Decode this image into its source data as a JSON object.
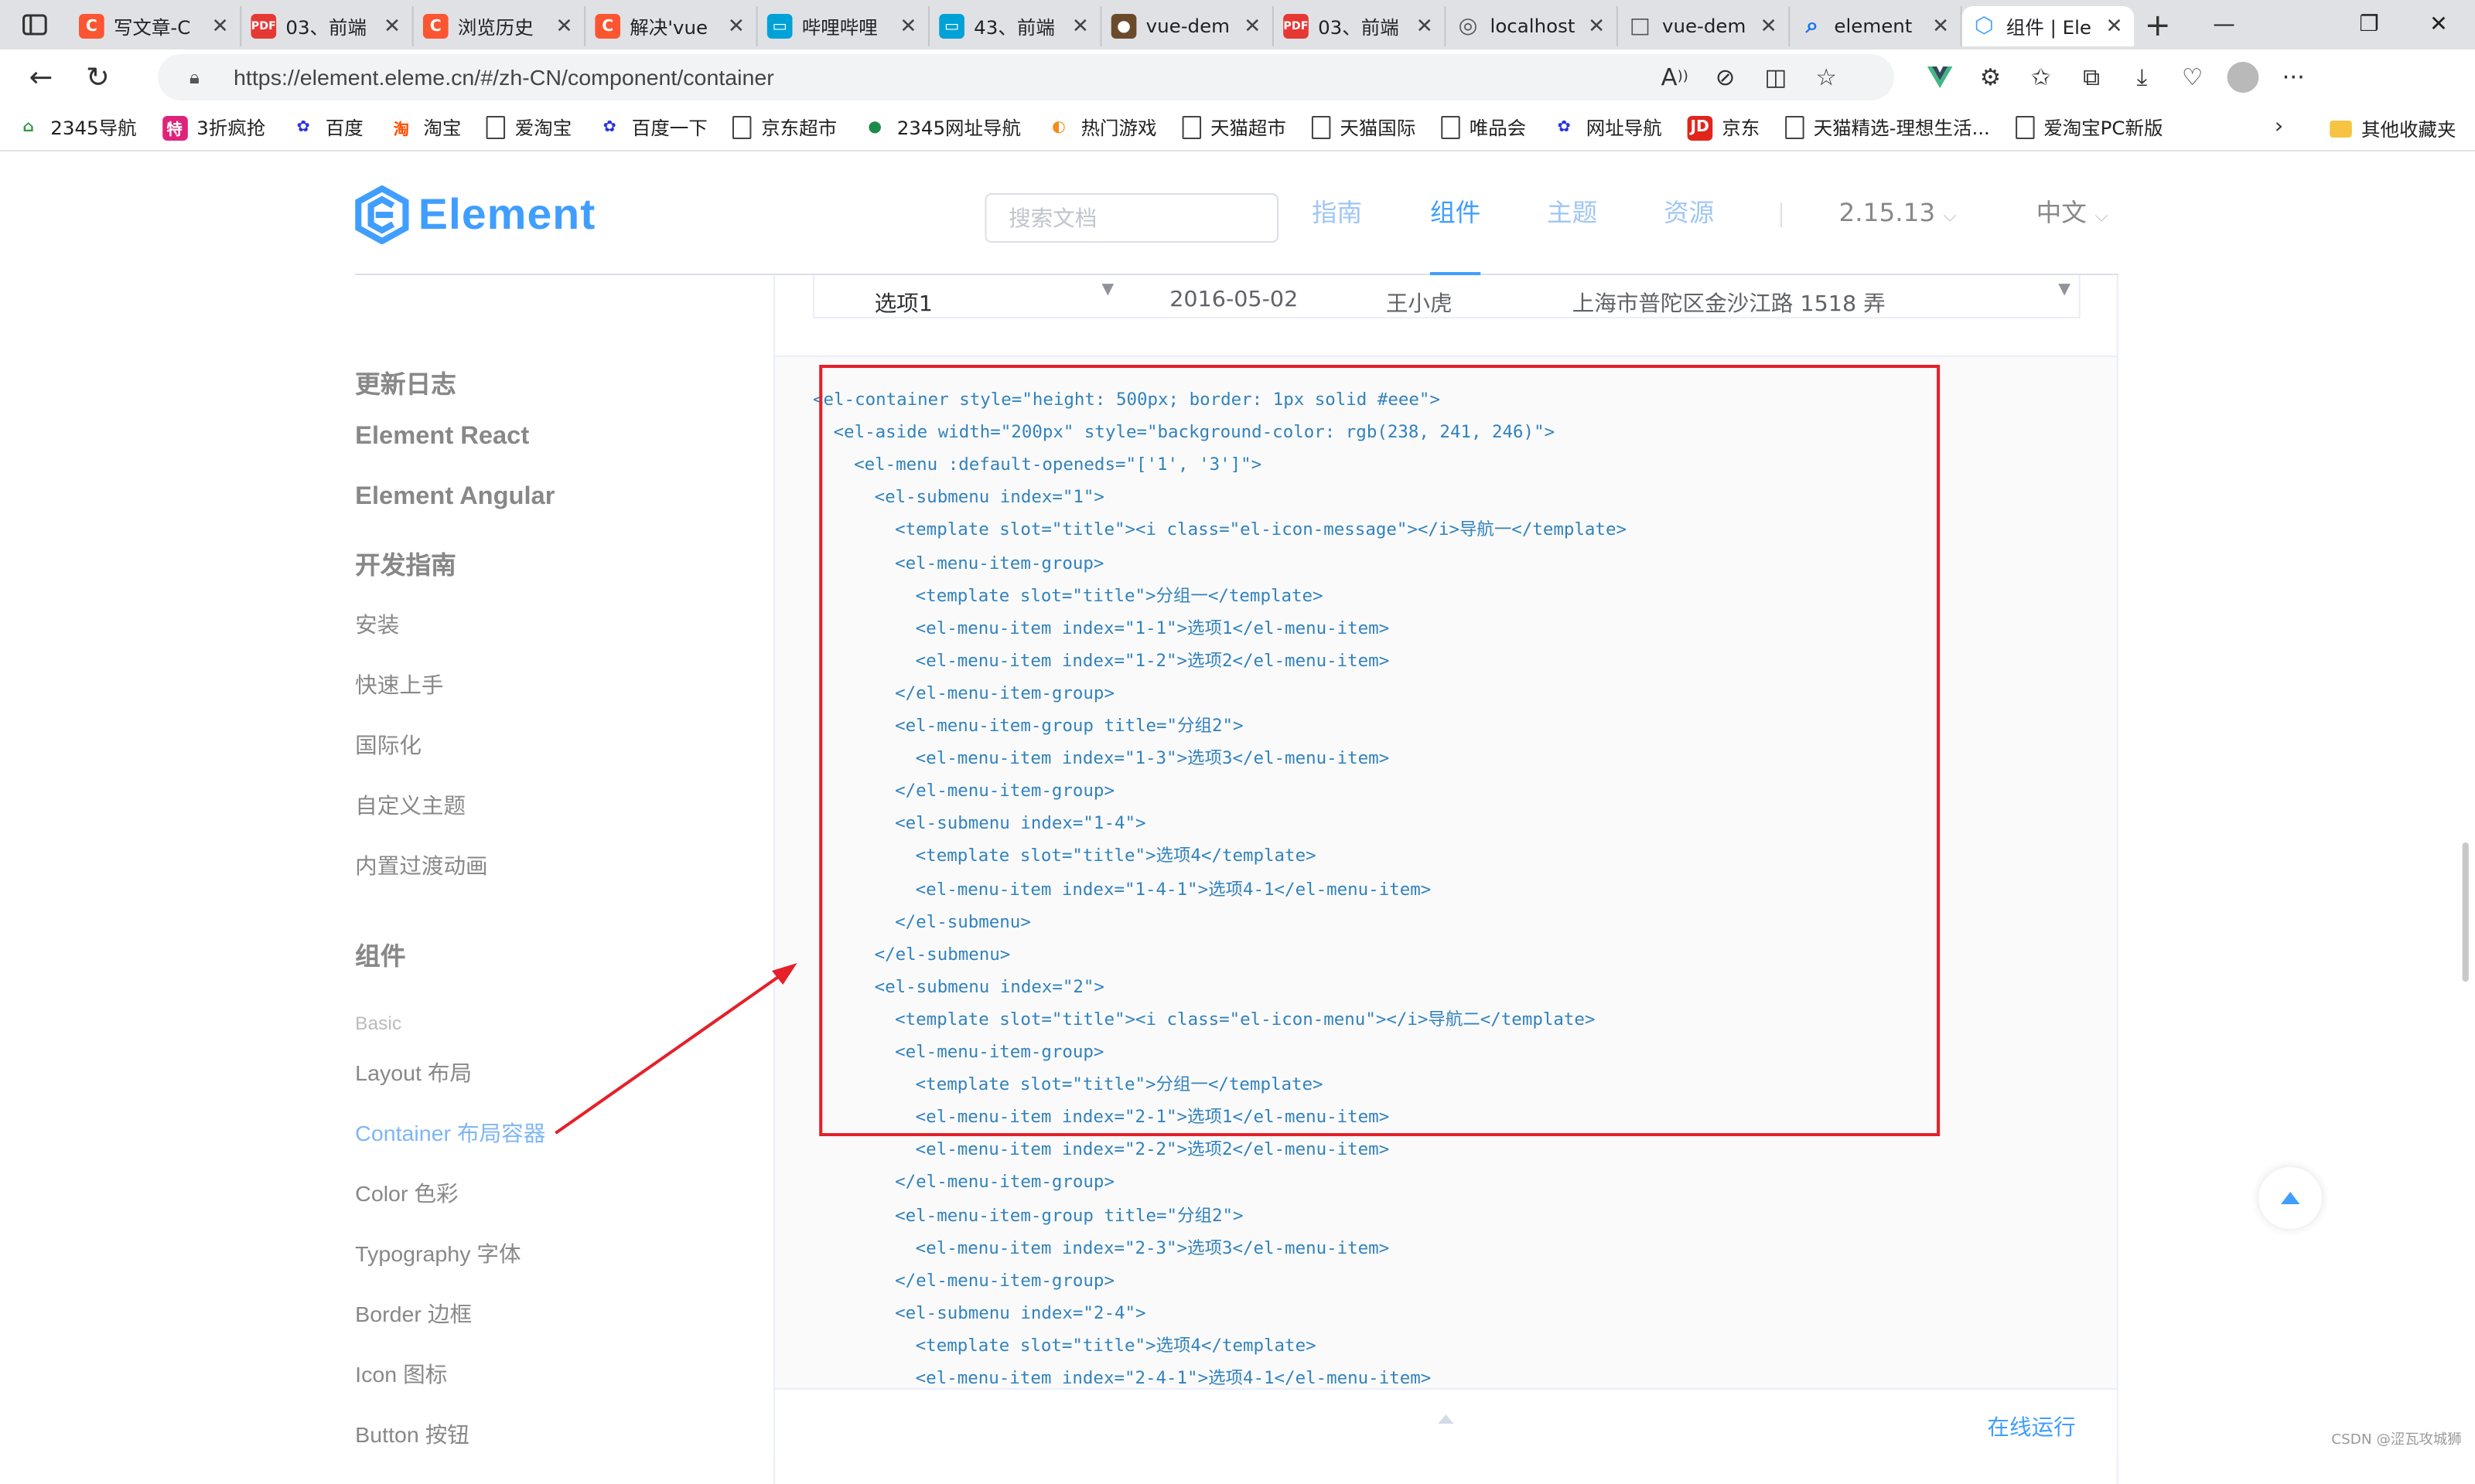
{
  "browser": {
    "tabs": [
      {
        "title": "写文章-C",
        "icon": "csdn-icon",
        "color": "#fc5531",
        "glyph": "C"
      },
      {
        "title": "03、前端",
        "icon": "pdf-icon",
        "color": "#e53935",
        "glyph": "PDF"
      },
      {
        "title": "浏览历史",
        "icon": "csdn-icon",
        "color": "#fc5531",
        "glyph": "C"
      },
      {
        "title": "解决'vue",
        "icon": "csdn-icon",
        "color": "#fc5531",
        "glyph": "C"
      },
      {
        "title": "哔哩哔哩",
        "icon": "bilibili-icon",
        "color": "#00a1d6",
        "glyph": "▭"
      },
      {
        "title": "43、前端",
        "icon": "bilibili-icon",
        "color": "#00a1d6",
        "glyph": "▭"
      },
      {
        "title": "vue-dem",
        "icon": "avatar-icon",
        "color": "#6b4a2b",
        "glyph": "●"
      },
      {
        "title": "03、前端",
        "icon": "pdf-icon",
        "color": "#e53935",
        "glyph": "PDF"
      },
      {
        "title": "localhost",
        "icon": "page-icon",
        "color": "#555555",
        "glyph": "◎"
      },
      {
        "title": "vue-dem",
        "icon": "page-icon",
        "color": "#555555",
        "glyph": "□"
      },
      {
        "title": "element",
        "icon": "search-icon",
        "color": "#1a73e8",
        "glyph": "⌕"
      },
      {
        "title": "组件 | Ele",
        "icon": "element-icon",
        "color": "#409eff",
        "glyph": "⬡",
        "active": true
      }
    ],
    "url": "https://element.eleme.cn/#/zh-CN/component/container"
  },
  "bookmarks": [
    {
      "label": "2345导航",
      "icon": "2345-icon",
      "color": "#2e9b3b",
      "glyph": "⌂"
    },
    {
      "label": "3折疯抢",
      "icon": "tmall-special-icon",
      "color": "#e0237a",
      "glyph": "特"
    },
    {
      "label": "百度",
      "icon": "baidu-icon",
      "color": "#2932e1",
      "glyph": "✿"
    },
    {
      "label": "淘宝",
      "icon": "taobao-icon",
      "color": "#ff5000",
      "glyph": "淘"
    },
    {
      "label": "爱淘宝",
      "icon": "page-icon",
      "color": "",
      "glyph": ""
    },
    {
      "label": "百度一下",
      "icon": "baidu-icon",
      "color": "#2932e1",
      "glyph": "✿"
    },
    {
      "label": "京东超市",
      "icon": "page-icon",
      "color": "",
      "glyph": ""
    },
    {
      "label": "2345网址导航",
      "icon": "2345-icon",
      "color": "#1e8a4a",
      "glyph": "●"
    },
    {
      "label": "热门游戏",
      "icon": "game-icon",
      "color": "#f28c1a",
      "glyph": "◐"
    },
    {
      "label": "天猫超市",
      "icon": "page-icon",
      "color": "",
      "glyph": ""
    },
    {
      "label": "天猫国际",
      "icon": "page-icon",
      "color": "",
      "glyph": ""
    },
    {
      "label": "唯品会",
      "icon": "page-icon",
      "color": "",
      "glyph": ""
    },
    {
      "label": "网址导航",
      "icon": "baidu-icon",
      "color": "#2932e1",
      "glyph": "✿"
    },
    {
      "label": "京东",
      "icon": "jd-icon",
      "color": "#e1251b",
      "glyph": "JD"
    },
    {
      "label": "天猫精选-理想生活...",
      "icon": "page-icon",
      "color": "",
      "glyph": ""
    },
    {
      "label": "爱淘宝PC新版",
      "icon": "page-icon",
      "color": "",
      "glyph": ""
    }
  ],
  "bookmarks_other": "其他收藏夹",
  "site": {
    "logo": "Element",
    "search_placeholder": "搜索文档",
    "nav": [
      "指南",
      "组件",
      "主题",
      "资源"
    ],
    "version": "2.15.13",
    "lang": "中文"
  },
  "sidebar": [
    {
      "label": "更新日志",
      "kind": "h"
    },
    {
      "label": "Element React",
      "kind": "h"
    },
    {
      "label": "Element Angular",
      "kind": "h"
    },
    {
      "label": "开发指南",
      "kind": "h"
    },
    {
      "label": "安装",
      "kind": "n"
    },
    {
      "label": "快速上手",
      "kind": "n"
    },
    {
      "label": "国际化",
      "kind": "n"
    },
    {
      "label": "自定义主题",
      "kind": "n"
    },
    {
      "label": "内置过渡动画",
      "kind": "n"
    },
    {
      "label": "组件",
      "kind": "h"
    },
    {
      "label": "Basic",
      "kind": "sm"
    },
    {
      "label": "Layout 布局",
      "kind": "n"
    },
    {
      "label": "Container 布局容器",
      "kind": "act"
    },
    {
      "label": "Color 色彩",
      "kind": "n"
    },
    {
      "label": "Typography 字体",
      "kind": "n"
    },
    {
      "label": "Border 边框",
      "kind": "n"
    },
    {
      "label": "Icon 图标",
      "kind": "n"
    },
    {
      "label": "Button 按钮",
      "kind": "n"
    }
  ],
  "demo_row": {
    "menu_item": "选项1",
    "date": "2016-05-02",
    "name": "王小虎",
    "address": "上海市普陀区金沙江路 1518 弄"
  },
  "code_lines": [
    {
      "indent": 0,
      "code": "<el-container style=\"height: 500px; border: 1px solid #eee\">"
    },
    {
      "indent": 1,
      "code": "<el-aside width=\"200px\" style=\"background-color: rgb(238, 241, 246)\">"
    },
    {
      "indent": 2,
      "code": "<el-menu :default-openeds=\"['1', '3']\">"
    },
    {
      "indent": 3,
      "code": "<el-submenu index=\"1\">"
    },
    {
      "indent": 4,
      "code": "<template slot=\"title\"><i class=\"el-icon-message\"></i>导航一</template>"
    },
    {
      "indent": 4,
      "code": "<el-menu-item-group>"
    },
    {
      "indent": 5,
      "code": "<template slot=\"title\">分组一</template>"
    },
    {
      "indent": 5,
      "code": "<el-menu-item index=\"1-1\">选项1</el-menu-item>"
    },
    {
      "indent": 5,
      "code": "<el-menu-item index=\"1-2\">选项2</el-menu-item>"
    },
    {
      "indent": 4,
      "code": "</el-menu-item-group>"
    },
    {
      "indent": 4,
      "code": "<el-menu-item-group title=\"分组2\">"
    },
    {
      "indent": 5,
      "code": "<el-menu-item index=\"1-3\">选项3</el-menu-item>"
    },
    {
      "indent": 4,
      "code": "</el-menu-item-group>"
    },
    {
      "indent": 4,
      "code": "<el-submenu index=\"1-4\">"
    },
    {
      "indent": 5,
      "code": "<template slot=\"title\">选项4</template>"
    },
    {
      "indent": 5,
      "code": "<el-menu-item index=\"1-4-1\">选项4-1</el-menu-item>"
    },
    {
      "indent": 4,
      "code": "</el-submenu>"
    },
    {
      "indent": 3,
      "code": "</el-submenu>"
    },
    {
      "indent": 3,
      "code": "<el-submenu index=\"2\">"
    },
    {
      "indent": 4,
      "code": "<template slot=\"title\"><i class=\"el-icon-menu\"></i>导航二</template>"
    },
    {
      "indent": 4,
      "code": "<el-menu-item-group>"
    },
    {
      "indent": 5,
      "code": "<template slot=\"title\">分组一</template>"
    },
    {
      "indent": 5,
      "code": "<el-menu-item index=\"2-1\">选项1</el-menu-item>"
    },
    {
      "indent": 5,
      "code": "<el-menu-item index=\"2-2\">选项2</el-menu-item>"
    },
    {
      "indent": 4,
      "code": "</el-menu-item-group>"
    },
    {
      "indent": 4,
      "code": "<el-menu-item-group title=\"分组2\">"
    },
    {
      "indent": 5,
      "code": "<el-menu-item index=\"2-3\">选项3</el-menu-item>"
    },
    {
      "indent": 4,
      "code": "</el-menu-item-group>"
    },
    {
      "indent": 4,
      "code": "<el-submenu index=\"2-4\">"
    },
    {
      "indent": 5,
      "code": "<template slot=\"title\">选项4</template>"
    },
    {
      "indent": 5,
      "code": "<el-menu-item index=\"2-4-1\">选项4-1</el-menu-item>"
    }
  ],
  "run_link": "在线运行",
  "watermark": "CSDN @涩瓦攻城狮",
  "colors": {
    "accent": "#409eff",
    "annotation": "#e5202a"
  }
}
